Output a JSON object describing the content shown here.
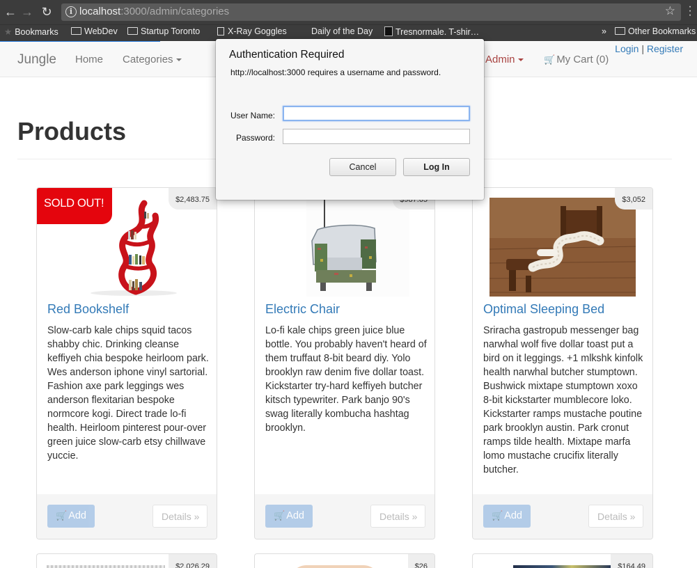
{
  "browser": {
    "url_host": "localhost",
    "url_path": ":3000/admin/categories",
    "bookmarks": [
      {
        "label": "Bookmarks",
        "icon": "star-icon"
      },
      {
        "label": "WebDev",
        "icon": "folder-icon"
      },
      {
        "label": "Startup Toronto",
        "icon": "folder-icon"
      },
      {
        "label": "X-Ray Goggles",
        "icon": "page-icon"
      },
      {
        "label": "Daily of the Day",
        "icon": "none"
      },
      {
        "label": "Tresnormale. T-shir…",
        "icon": "favicon"
      },
      {
        "label": "»",
        "icon": "none"
      },
      {
        "label": "Other Bookmarks",
        "icon": "folder-icon"
      }
    ]
  },
  "navbar": {
    "brand": "Jungle",
    "home": "Home",
    "categories": "Categories",
    "admin": "Admin",
    "cart": "My Cart (0)",
    "login": "Login",
    "separator": "|",
    "register": "Register"
  },
  "page": {
    "title": "Products"
  },
  "products": [
    {
      "name": "Red Bookshelf",
      "price": "$2,483.75",
      "badge": "SOLD OUT!",
      "description": "Slow-carb kale chips squid tacos shabby chic. Drinking cleanse keffiyeh chia bespoke heirloom park. Wes anderson iphone vinyl sartorial. Fashion axe park leggings wes anderson flexitarian bespoke normcore kogi. Direct trade lo-fi health. Heirloom pinterest pour-over green juice slow-carb etsy chillwave yuccie.",
      "add_label": "Add",
      "details_label": "Details »"
    },
    {
      "name": "Electric Chair",
      "price": "$987.65",
      "description": "Lo-fi kale chips green juice blue bottle. You probably haven't heard of them truffaut 8-bit beard diy. Yolo brooklyn raw denim five dollar toast. Kickstarter try-hard keffiyeh butcher kitsch typewriter. Park banjo 90's swag literally kombucha hashtag brooklyn.",
      "add_label": "Add",
      "details_label": "Details »"
    },
    {
      "name": "Optimal Sleeping Bed",
      "price": "$3,052",
      "description": "Sriracha gastropub messenger bag narwhal wolf five dollar toast put a bird on it leggings. +1 mlkshk kinfolk health narwhal butcher stumptown. Bushwick mixtape stumptown xoxo 8-bit kickstarter mumblecore loko. Kickstarter ramps mustache poutine park brooklyn austin. Park cronut ramps tilde health. Mixtape marfa lomo mustache crucifix literally butcher.",
      "add_label": "Add",
      "details_label": "Details »"
    }
  ],
  "partial_prices": [
    "$2,026.29",
    "$26",
    "$164.49"
  ],
  "dialog": {
    "title": "Authentication Required",
    "message": "http://localhost:3000 requires a username and password.",
    "username_label": "User Name:",
    "password_label": "Password:",
    "username_value": "",
    "password_value": "",
    "cancel_label": "Cancel",
    "login_label": "Log In"
  },
  "colors": {
    "link": "#337ab7",
    "sold_out": "#e4050d",
    "admin": "#a94442",
    "chrome": "#3c3c3c"
  }
}
